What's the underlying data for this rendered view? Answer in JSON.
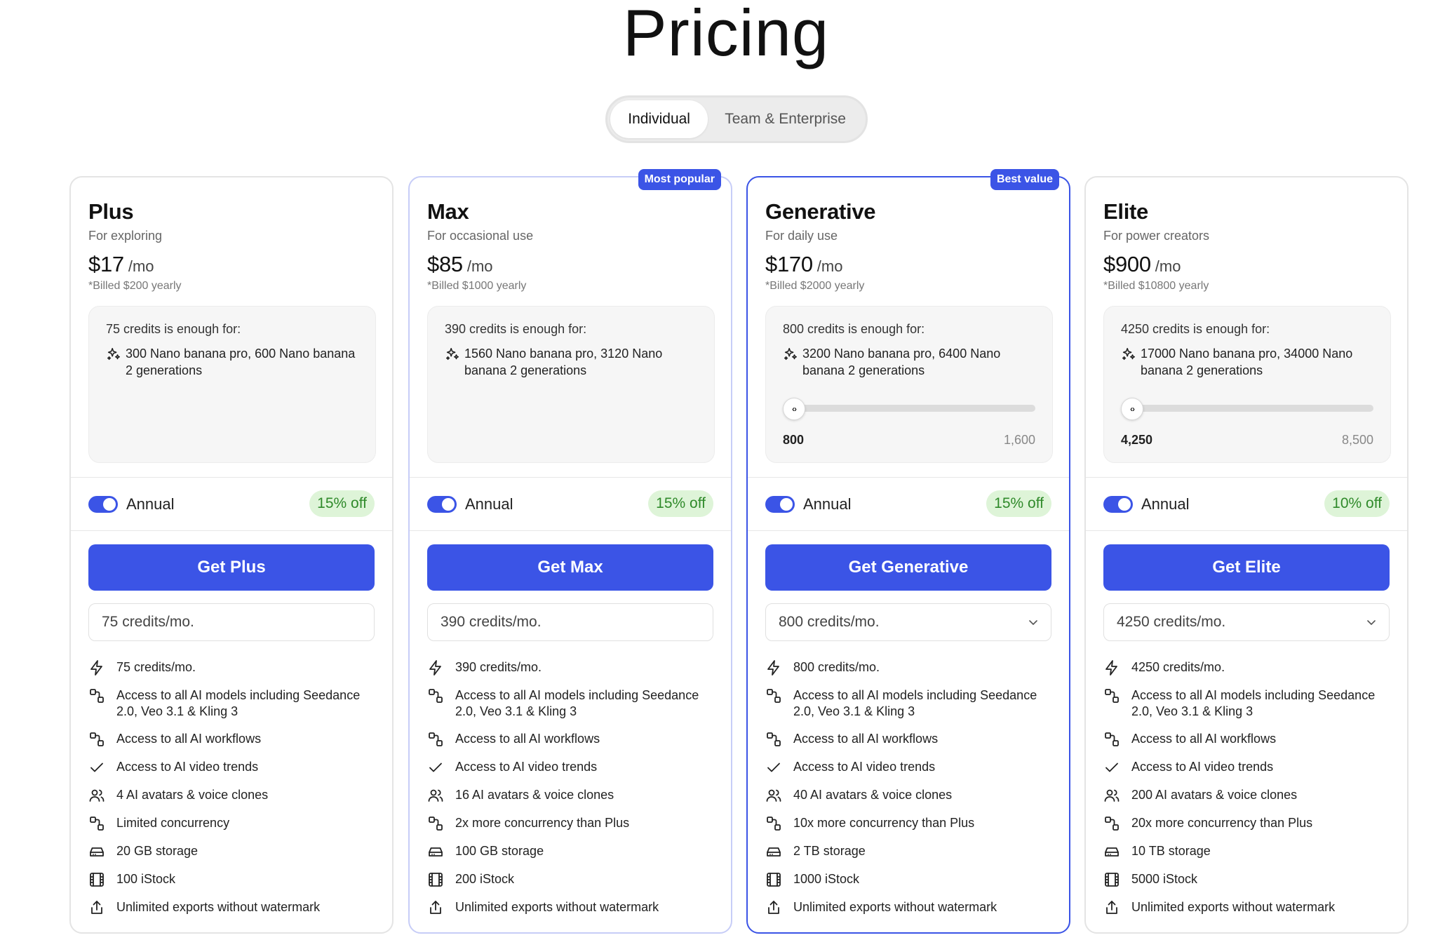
{
  "title": "Pricing",
  "tabs": {
    "individual": "Individual",
    "team": "Team & Enterprise"
  },
  "colors": {
    "accent": "#3b54e6",
    "discount_bg": "#def4d8",
    "discount_text": "#2f8a2a"
  },
  "plans": [
    {
      "name": "Plus",
      "subtitle": "For exploring",
      "price": "$17",
      "per": "/mo",
      "billed": "*Billed $200 yearly",
      "badge": "",
      "credits_title": "75 credits is enough for:",
      "credits_line": "300 Nano banana pro, 600 Nano banana 2 generations",
      "slider_min": "",
      "slider_max": "",
      "annual_label": "Annual",
      "discount": "15% off",
      "cta": "Get Plus",
      "credits_select": "75 credits/mo.",
      "features": [
        "75 credits/mo.",
        "Access to all AI models including Seedance 2.0, Veo 3.1 & Kling 3",
        "Access to all AI workflows",
        "Access to AI video trends",
        "4 AI avatars & voice clones",
        "Limited concurrency",
        "20 GB storage",
        "100 iStock",
        "Unlimited exports without watermark"
      ]
    },
    {
      "name": "Max",
      "subtitle": "For occasional use",
      "price": "$85",
      "per": "/mo",
      "billed": "*Billed $1000 yearly",
      "badge": "Most popular",
      "credits_title": "390 credits is enough for:",
      "credits_line": "1560 Nano banana pro, 3120 Nano banana 2 generations",
      "slider_min": "",
      "slider_max": "",
      "annual_label": "Annual",
      "discount": "15% off",
      "cta": "Get Max",
      "credits_select": "390 credits/mo.",
      "features": [
        "390 credits/mo.",
        "Access to all AI models including Seedance 2.0, Veo 3.1 & Kling 3",
        "Access to all AI workflows",
        "Access to AI video trends",
        "16 AI avatars & voice clones",
        "2x more concurrency than Plus",
        "100 GB storage",
        "200 iStock",
        "Unlimited exports without watermark"
      ]
    },
    {
      "name": "Generative",
      "subtitle": "For daily use",
      "price": "$170",
      "per": "/mo",
      "billed": "*Billed $2000 yearly",
      "badge": "Best value",
      "credits_title": "800 credits is enough for:",
      "credits_line": "3200 Nano banana pro, 6400 Nano banana 2 generations",
      "slider_min": "800",
      "slider_max": "1,600",
      "annual_label": "Annual",
      "discount": "15% off",
      "cta": "Get Generative",
      "credits_select": "800 credits/mo.",
      "features": [
        "800 credits/mo.",
        "Access to all AI models including Seedance 2.0, Veo 3.1 & Kling 3",
        "Access to all AI workflows",
        "Access to AI video trends",
        "40 AI avatars & voice clones",
        "10x more concurrency than Plus",
        "2 TB storage",
        "1000 iStock",
        "Unlimited exports without watermark"
      ]
    },
    {
      "name": "Elite",
      "subtitle": "For power creators",
      "price": "$900",
      "per": "/mo",
      "billed": "*Billed $10800 yearly",
      "badge": "",
      "credits_title": "4250 credits is enough for:",
      "credits_line": "17000 Nano banana pro, 34000 Nano banana 2 generations",
      "slider_min": "4,250",
      "slider_max": "8,500",
      "annual_label": "Annual",
      "discount": "10% off",
      "cta": "Get Elite",
      "credits_select": "4250 credits/mo.",
      "features": [
        "4250 credits/mo.",
        "Access to all AI models including Seedance 2.0, Veo 3.1 & Kling 3",
        "Access to all AI workflows",
        "Access to AI video trends",
        "200 AI avatars & voice clones",
        "20x more concurrency than Plus",
        "10 TB storage",
        "5000 iStock",
        "Unlimited exports without watermark"
      ]
    }
  ],
  "feature_icons": [
    "bolt-icon",
    "workflow-icon",
    "workflow-icon",
    "check-icon",
    "users-icon",
    "workflow-icon",
    "storage-icon",
    "film-icon",
    "export-icon"
  ]
}
